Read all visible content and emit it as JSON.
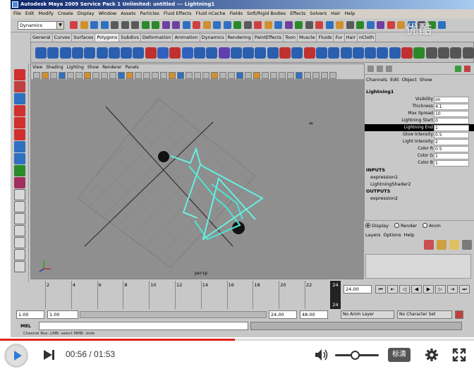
{
  "app": {
    "title": "Autodesk Maya 2009 Service Pack 1 Unlimited: untitled   ---   Lightning1",
    "menu": [
      "File",
      "Edit",
      "Modify",
      "Create",
      "Display",
      "Window",
      "Assets",
      "Particles",
      "Fluid Effects",
      "Fluid nCache",
      "Fields",
      "Soft/Rigid Bodies",
      "Effects",
      "Solvers",
      "Hair",
      "Help"
    ],
    "mode": "Dynamics"
  },
  "shelf": {
    "tabs": [
      "General",
      "Curves",
      "Surfaces",
      "Polygons",
      "Subdivs",
      "Deformation",
      "Animation",
      "Dynamics",
      "Rendering",
      "PaintEffects",
      "Toon",
      "Muscle",
      "Fluids",
      "Fur",
      "Hair",
      "nCloth"
    ],
    "active_tab": "Polygons"
  },
  "viewport": {
    "menu": [
      "View",
      "Shading",
      "Lighting",
      "Show",
      "Renderer",
      "Panels"
    ],
    "camera_label": "persp"
  },
  "channel_box": {
    "menu": [
      "Channels",
      "Edit",
      "Object",
      "Show"
    ],
    "object": "Lightning1",
    "attributes": [
      {
        "name": "Visibility",
        "value": "on"
      },
      {
        "name": "Thickness",
        "value": "4.1"
      },
      {
        "name": "Max Spread",
        "value": "10"
      },
      {
        "name": "Lightning Start",
        "value": "0"
      },
      {
        "name": "Lightning End",
        "value": "1",
        "selected": true
      },
      {
        "name": "Glow Intensity",
        "value": "0.5"
      },
      {
        "name": "Light Intensity",
        "value": "2"
      },
      {
        "name": "Color R",
        "value": "0.5"
      },
      {
        "name": "Color G",
        "value": "1"
      },
      {
        "name": "Color B",
        "value": "1"
      }
    ],
    "inputs_header": "INPUTS",
    "inputs": [
      "expression1",
      "LightningShader2"
    ],
    "outputs_header": "OUTPUTS",
    "outputs": [
      "expression2"
    ]
  },
  "layers": {
    "radio": [
      {
        "label": "Display",
        "checked": true
      },
      {
        "label": "Render",
        "checked": false
      },
      {
        "label": "Anim",
        "checked": false
      }
    ],
    "menu": [
      "Layers",
      "Options",
      "Help"
    ]
  },
  "timeline": {
    "ticks": [
      "2",
      "4",
      "6",
      "8",
      "10",
      "12",
      "14",
      "16",
      "18",
      "20",
      "22"
    ],
    "current_frame": "24",
    "current_frame_field": "24.00"
  },
  "range": {
    "start": "1.00",
    "playback_start": "1.00",
    "playback_end": "24.00",
    "end": "48.00",
    "anim_layer": "No Anim Layer",
    "character_set": "No Character Set"
  },
  "command_line": {
    "label": "MEL",
    "help": "Channel Box: LMB: select  MMB: slide"
  },
  "watermark": "优酷",
  "player": {
    "current_time": "00:56",
    "total_time": "01:53",
    "progress": 0.495,
    "volume": 0.45,
    "quality_label": "标清",
    "accent": "#e2231a"
  }
}
